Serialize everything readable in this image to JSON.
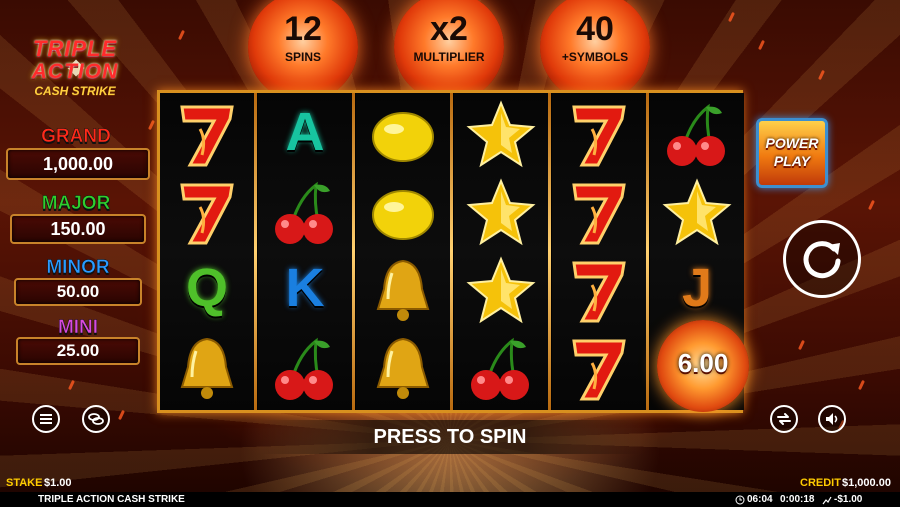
{
  "logo": {
    "line1": "TRIPLE",
    "line2": "ACTION",
    "line3": "CASH STRIKE"
  },
  "jackpots": [
    {
      "name": "GRAND",
      "value": "1,000.00",
      "color": "#ff2a1a"
    },
    {
      "name": "MAJOR",
      "value": "150.00",
      "color": "#2ecf2e"
    },
    {
      "name": "MINOR",
      "value": "50.00",
      "color": "#2a9aff"
    },
    {
      "name": "MINI",
      "value": "25.00",
      "color": "#d94adf"
    }
  ],
  "counters": [
    {
      "value": "12",
      "label": "SPINS"
    },
    {
      "value": "x2",
      "label": "MULTIPLIER"
    },
    {
      "value": "40",
      "label": "+SYMBOLS"
    }
  ],
  "reels": [
    [
      "seven",
      "seven",
      "Q",
      "bell"
    ],
    [
      "A",
      "cherry",
      "K",
      "cherry"
    ],
    [
      "lemon",
      "lemon",
      "bell",
      "bell"
    ],
    [
      "star",
      "star",
      "star",
      "cherry"
    ],
    [
      "seven",
      "seven",
      "seven",
      "seven"
    ],
    [
      "cherry",
      "star",
      "J",
      "cash"
    ]
  ],
  "letter_colors": {
    "A": "#17c4a0",
    "K": "#1a7fe0",
    "Q": "#4fc02a",
    "J": "#e07a1a"
  },
  "cash_symbol_value": "6.00",
  "power_play": {
    "line1": "POWER",
    "line2": "PLAY"
  },
  "spin_prompt": "PRESS TO SPIN",
  "status": {
    "stake_label": "STAKE",
    "stake_value": "$1.00",
    "credit_label": "CREDIT",
    "credit_value": "$1,000.00"
  },
  "footer": {
    "game_title": "TRIPLE ACTION CASH STRIKE",
    "clock": "06:04",
    "session_time": "0:00:18",
    "net": "-$1.00"
  },
  "icons": {
    "menu": "menu-icon",
    "coins": "coins-icon",
    "spin": "spin-icon",
    "autoplay": "autoplay-icon",
    "sound": "sound-icon",
    "clock": "clock-icon",
    "net": "chart-icon"
  }
}
